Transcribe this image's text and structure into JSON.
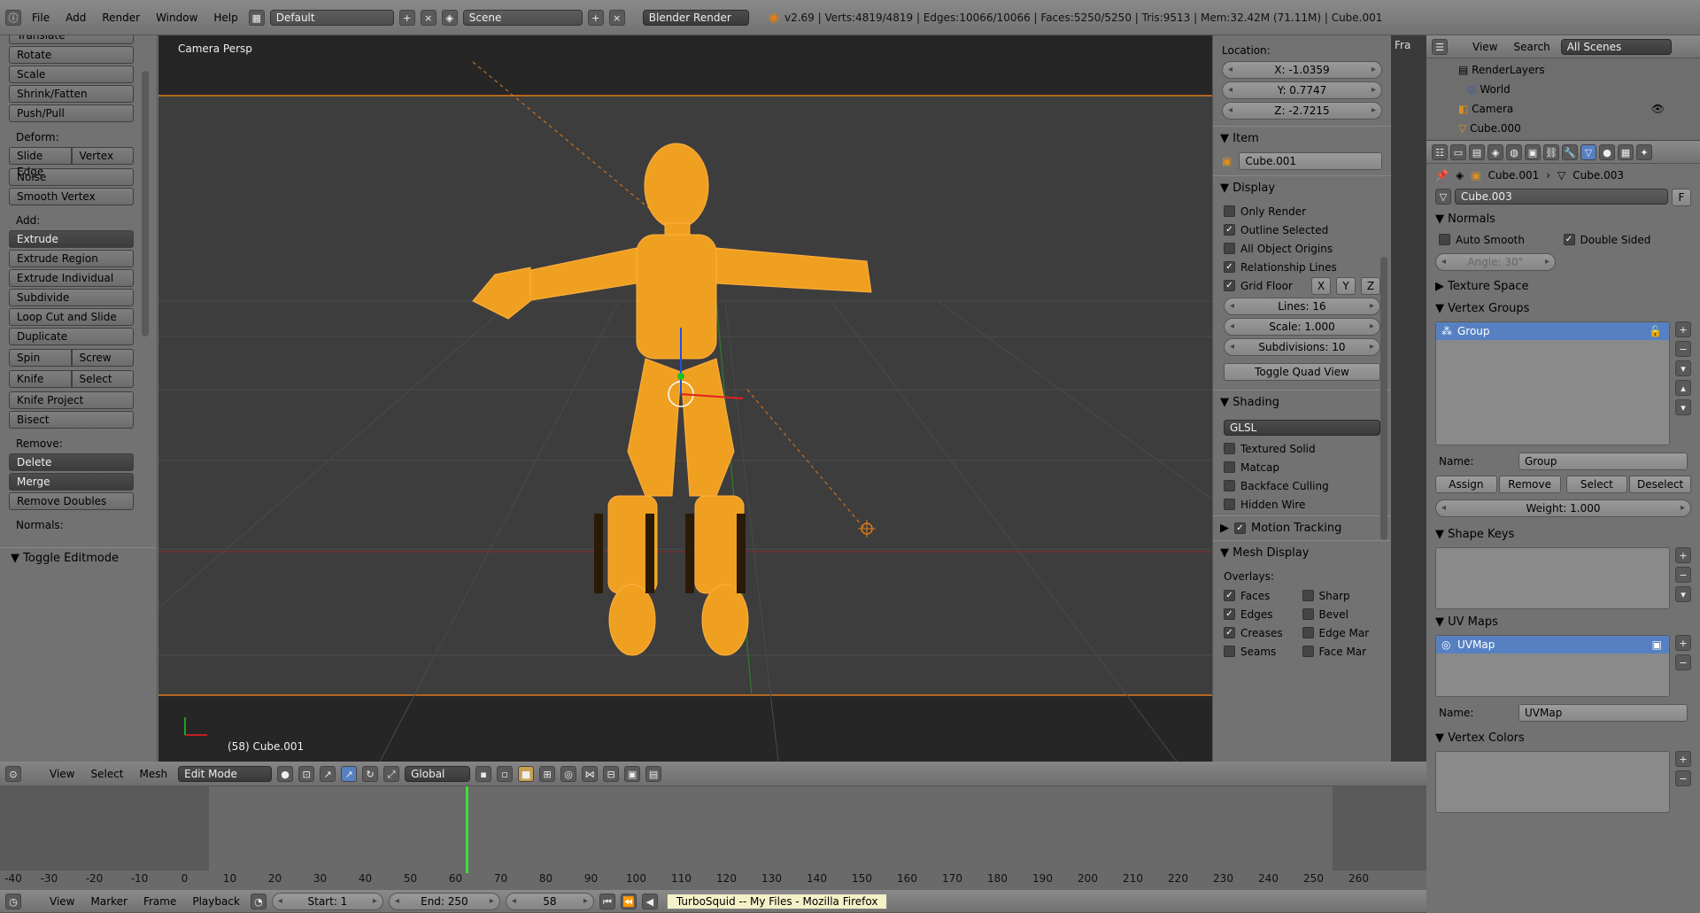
{
  "topbar": {
    "menus": [
      "File",
      "Add",
      "Render",
      "Window",
      "Help"
    ],
    "layout": "Default",
    "scene": "Scene",
    "engine": "Blender Render",
    "stats": "v2.69 | Verts:4819/4819 | Edges:10066/10066 | Faces:5250/5250 | Tris:9513 | Mem:32.42M (71.11M) | Cube.001"
  },
  "toolshelf": {
    "transform_items": [
      "Translate",
      "Rotate",
      "Scale",
      "Shrink/Fatten",
      "Push/Pull"
    ],
    "deform_label": "Deform:",
    "slide_edge": "Slide Edge",
    "vertex": "Vertex",
    "noise": "Noise",
    "smooth_vertex": "Smooth Vertex",
    "add_label": "Add:",
    "extrude": "Extrude",
    "extrude_region": "Extrude Region",
    "extrude_individual": "Extrude Individual",
    "subdivide": "Subdivide",
    "loop_cut": "Loop Cut and Slide",
    "duplicate": "Duplicate",
    "spin": "Spin",
    "screw": "Screw",
    "knife": "Knife",
    "select": "Select",
    "knife_project": "Knife Project",
    "bisect": "Bisect",
    "remove_label": "Remove:",
    "delete": "Delete",
    "merge": "Merge",
    "remove_doubles": "Remove Doubles",
    "normals_label": "Normals:",
    "toggle_editmode": "Toggle Editmode"
  },
  "viewport": {
    "view_name": "Camera Persp",
    "object_label": "(58) Cube.001"
  },
  "viewport_header": {
    "menus": [
      "View",
      "Select",
      "Mesh"
    ],
    "mode": "Edit Mode",
    "orientation": "Global"
  },
  "npanel": {
    "location_label": "Location:",
    "x": "X: -1.0359",
    "y": "Y: 0.7747",
    "z": "Z: -2.7215",
    "item_title": "Item",
    "item_name": "Cube.001",
    "display_title": "Display",
    "only_render": "Only Render",
    "outline_selected": "Outline Selected",
    "all_object_origins": "All Object Origins",
    "relationship_lines": "Relationship Lines",
    "grid_floor": "Grid Floor",
    "axis_x": "X",
    "axis_y": "Y",
    "axis_z": "Z",
    "lines": "Lines: 16",
    "scale": "Scale: 1.000",
    "subdivisions": "Subdivisions: 10",
    "toggle_quad": "Toggle Quad View",
    "shading_title": "Shading",
    "shading_mode": "GLSL",
    "textured_solid": "Textured Solid",
    "matcap": "Matcap",
    "backface_culling": "Backface Culling",
    "hidden_wire": "Hidden Wire",
    "motion_tracking": "Motion Tracking",
    "mesh_display": "Mesh Display",
    "overlays": "Overlays:",
    "faces": "Faces",
    "sharp": "Sharp",
    "edges": "Edges",
    "bevel": "Bevel",
    "creases": "Creases",
    "edge_mar": "Edge Mar",
    "seams": "Seams",
    "face_mar": "Face Mar"
  },
  "outliner": {
    "menus": [
      "View",
      "Search"
    ],
    "scope": "All Scenes",
    "items": [
      "RenderLayers",
      "World",
      "Camera",
      "Cube.000"
    ]
  },
  "properties": {
    "breadcrumb_object": "Cube.001",
    "breadcrumb_mesh": "Cube.003",
    "mesh_name": "Cube.003",
    "fake_user": "F",
    "normals_title": "Normals",
    "auto_smooth": "Auto Smooth",
    "double_sided": "Double Sided",
    "angle": "Angle: 30°",
    "texture_space": "Texture Space",
    "vertex_groups": "Vertex Groups",
    "group_item": "Group",
    "name_label": "Name:",
    "group_name": "Group",
    "assign": "Assign",
    "remove": "Remove",
    "select": "Select",
    "deselect": "Deselect",
    "weight": "Weight: 1.000",
    "shape_keys": "Shape Keys",
    "uv_maps": "UV Maps",
    "uv_item": "UVMap",
    "uv_name_label": "Name:",
    "uv_name": "UVMap",
    "vertex_colors": "Vertex Colors"
  },
  "timeline": {
    "ruler": [
      "-40",
      "-30",
      "-20",
      "-10",
      "0",
      "10",
      "20",
      "30",
      "40",
      "50",
      "60",
      "70",
      "80",
      "90",
      "100",
      "110",
      "120",
      "130",
      "140",
      "150",
      "160",
      "170",
      "180",
      "190",
      "200",
      "210",
      "220",
      "230",
      "240",
      "250",
      "260"
    ],
    "current_frame_marker": 58
  },
  "timeline_header": {
    "menus": [
      "View",
      "Marker",
      "Frame",
      "Playback"
    ],
    "start": "Start: 1",
    "end": "End: 250",
    "current": "58",
    "tooltip": "TurboSquid -- My Files - Mozilla Firefox"
  },
  "side_tab": "Fra"
}
